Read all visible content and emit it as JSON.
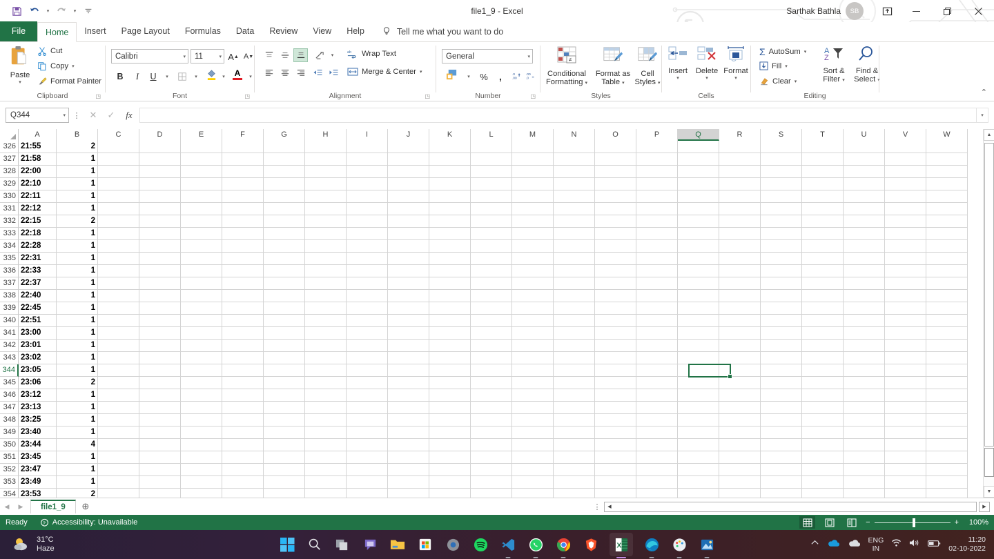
{
  "titlebar": {
    "document_title": "file1_9 - Excel",
    "user_name": "Sarthak Bathla",
    "user_initials": "SB",
    "qat": [
      {
        "name": "save-icon",
        "label": "Save"
      },
      {
        "name": "undo-icon",
        "label": "Undo"
      },
      {
        "name": "redo-icon",
        "label": "Redo"
      },
      {
        "name": "customize-qat-icon",
        "label": "Customize Quick Access Toolbar"
      }
    ],
    "ribbon_display_options": "Ribbon Display Options",
    "minimize": "Minimize",
    "restore": "Restore Down",
    "close": "Close",
    "comments": "Comments"
  },
  "menu": {
    "file": "File",
    "tabs": [
      {
        "label": "Home",
        "active": true
      },
      {
        "label": "Insert",
        "active": false
      },
      {
        "label": "Page Layout",
        "active": false
      },
      {
        "label": "Formulas",
        "active": false
      },
      {
        "label": "Data",
        "active": false
      },
      {
        "label": "Review",
        "active": false
      },
      {
        "label": "View",
        "active": false
      },
      {
        "label": "Help",
        "active": false
      }
    ],
    "tell_me": "Tell me what you want to do"
  },
  "ribbon": {
    "groups": [
      {
        "name": "Clipboard"
      },
      {
        "name": "Font"
      },
      {
        "name": "Alignment"
      },
      {
        "name": "Number"
      },
      {
        "name": "Styles"
      },
      {
        "name": "Cells"
      },
      {
        "name": "Editing"
      }
    ],
    "clipboard": {
      "paste": "Paste",
      "cut": "Cut",
      "copy": "Copy",
      "format_painter": "Format Painter",
      "label": "Clipboard"
    },
    "font": {
      "font_name": "Calibri",
      "font_size": "11",
      "grow_font": "A",
      "shrink_font": "A",
      "bold": "B",
      "italic": "I",
      "underline": "U",
      "borders": "Borders",
      "fill_color": "Fill Color",
      "font_color": "A",
      "label": "Font"
    },
    "alignment": {
      "top_align": "Top Align",
      "middle_align": "Middle Align",
      "bottom_align": "Bottom Align",
      "orientation": "Orientation",
      "align_left": "Align Left",
      "center": "Center",
      "align_right": "Align Right",
      "decrease_indent": "Decrease Indent",
      "increase_indent": "Increase Indent",
      "wrap_text": "Wrap Text",
      "merge_center": "Merge & Center",
      "label": "Alignment"
    },
    "number": {
      "format": "General",
      "accounting": "Accounting Number Format",
      "percent": "%",
      "comma": ",",
      "increase_decimal": "Increase Decimal",
      "decrease_decimal": "Decrease Decimal",
      "label": "Number"
    },
    "styles": {
      "conditional_formatting": "Conditional\nFormatting",
      "conditional_formatting_l1": "Conditional",
      "conditional_formatting_l2": "Formatting",
      "format_as_table_l1": "Format as",
      "format_as_table_l2": "Table",
      "cell_styles_l1": "Cell",
      "cell_styles_l2": "Styles",
      "label": "Styles"
    },
    "cells": {
      "insert": "Insert",
      "delete": "Delete",
      "format": "Format",
      "label": "Cells"
    },
    "editing": {
      "autosum": "AutoSum",
      "fill": "Fill",
      "clear": "Clear",
      "sort_filter_l1": "Sort &",
      "sort_filter_l2": "Filter",
      "find_select_l1": "Find &",
      "find_select_l2": "Select",
      "label": "Editing"
    },
    "collapse": "Collapse the Ribbon"
  },
  "formula_bar": {
    "name_box": "Q344",
    "cancel": "Cancel",
    "enter": "Enter",
    "insert_function": "fx",
    "formula_value": ""
  },
  "grid": {
    "columns": [
      "A",
      "B",
      "C",
      "D",
      "E",
      "F",
      "G",
      "H",
      "I",
      "J",
      "K",
      "L",
      "M",
      "N",
      "O",
      "P",
      "Q",
      "R",
      "S",
      "T",
      "U",
      "V",
      "W"
    ],
    "selected_column": "Q",
    "selected_row": 344,
    "selected_cell": "Q344",
    "rows": [
      {
        "n": 326,
        "a": "21:55",
        "b": "2"
      },
      {
        "n": 327,
        "a": "21:58",
        "b": "1"
      },
      {
        "n": 328,
        "a": "22:00",
        "b": "1"
      },
      {
        "n": 329,
        "a": "22:10",
        "b": "1"
      },
      {
        "n": 330,
        "a": "22:11",
        "b": "1"
      },
      {
        "n": 331,
        "a": "22:12",
        "b": "1"
      },
      {
        "n": 332,
        "a": "22:15",
        "b": "2"
      },
      {
        "n": 333,
        "a": "22:18",
        "b": "1"
      },
      {
        "n": 334,
        "a": "22:28",
        "b": "1"
      },
      {
        "n": 335,
        "a": "22:31",
        "b": "1"
      },
      {
        "n": 336,
        "a": "22:33",
        "b": "1"
      },
      {
        "n": 337,
        "a": "22:37",
        "b": "1"
      },
      {
        "n": 338,
        "a": "22:40",
        "b": "1"
      },
      {
        "n": 339,
        "a": "22:45",
        "b": "1"
      },
      {
        "n": 340,
        "a": "22:51",
        "b": "1"
      },
      {
        "n": 341,
        "a": "23:00",
        "b": "1"
      },
      {
        "n": 342,
        "a": "23:01",
        "b": "1"
      },
      {
        "n": 343,
        "a": "23:02",
        "b": "1"
      },
      {
        "n": 344,
        "a": "23:05",
        "b": "1"
      },
      {
        "n": 345,
        "a": "23:06",
        "b": "2"
      },
      {
        "n": 346,
        "a": "23:12",
        "b": "1"
      },
      {
        "n": 347,
        "a": "23:13",
        "b": "1"
      },
      {
        "n": 348,
        "a": "23:25",
        "b": "1"
      },
      {
        "n": 349,
        "a": "23:40",
        "b": "1"
      },
      {
        "n": 350,
        "a": "23:44",
        "b": "4"
      },
      {
        "n": 351,
        "a": "23:45",
        "b": "1"
      },
      {
        "n": 352,
        "a": "23:47",
        "b": "1"
      },
      {
        "n": 353,
        "a": "23:49",
        "b": "1"
      },
      {
        "n": 354,
        "a": "23:53",
        "b": "2"
      }
    ]
  },
  "sheet_bar": {
    "first_sheet": "First Sheet",
    "prev_sheet": "Previous Sheet",
    "tabs": [
      {
        "label": "file1_9",
        "active": true
      }
    ],
    "add_sheet": "+"
  },
  "status_bar": {
    "state": "Ready",
    "accessibility": "Accessibility: Unavailable",
    "views": [
      {
        "name": "normal-view",
        "active": true
      },
      {
        "name": "page-layout-view",
        "active": false
      },
      {
        "name": "page-break-preview",
        "active": false
      }
    ],
    "zoom_out": "−",
    "zoom_in": "+",
    "zoom_level": "100%"
  },
  "taskbar": {
    "weather_temp": "31°C",
    "weather_desc": "Haze",
    "start": "Start",
    "search": "Search",
    "apps": [
      {
        "name": "task-view-icon",
        "running": false
      },
      {
        "name": "chat-icon",
        "running": false
      },
      {
        "name": "file-explorer-icon",
        "running": false
      },
      {
        "name": "microsoft-store-icon",
        "running": false
      },
      {
        "name": "settings-icon",
        "running": false
      },
      {
        "name": "spotify-icon",
        "running": false
      },
      {
        "name": "vscode-icon",
        "running": true
      },
      {
        "name": "whatsapp-icon",
        "running": true
      },
      {
        "name": "chrome-icon",
        "running": true
      },
      {
        "name": "brave-icon",
        "running": false
      },
      {
        "name": "excel-icon",
        "running": true
      },
      {
        "name": "edge-icon",
        "running": true
      },
      {
        "name": "paint-icon",
        "running": true
      },
      {
        "name": "photos-icon",
        "running": true
      }
    ],
    "tray": {
      "show_hidden": "Show hidden icons",
      "onedrive": "OneDrive",
      "cloud": "Cloud",
      "language_l1": "ENG",
      "language_l2": "IN",
      "wifi": "Wi-Fi",
      "volume": "Volume",
      "battery": "Battery",
      "time": "11:20",
      "date": "02-10-2022"
    }
  }
}
